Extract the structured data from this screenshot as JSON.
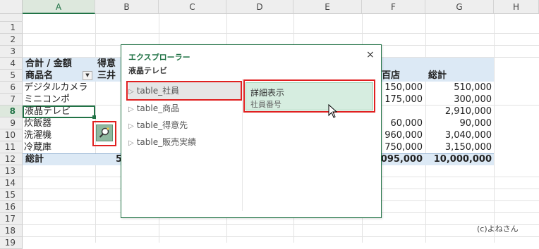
{
  "columns": [
    "A",
    "B",
    "C",
    "D",
    "E",
    "F",
    "G",
    "H"
  ],
  "rows": [
    "1",
    "2",
    "3",
    "4",
    "5",
    "6",
    "7",
    "8",
    "9",
    "10",
    "11",
    "12",
    "13",
    "14",
    "15",
    "16",
    "17",
    "18",
    "19"
  ],
  "sheet": {
    "r4_a": "合計 / 金額",
    "r4_b": "得意",
    "r5_a": "商品名",
    "r5_b": "三井",
    "r5_f": "百店",
    "r5_g": "総計",
    "r6_a": "デジタルカメラ",
    "r6_f": "150,000",
    "r6_g": "510,000",
    "r7_a": "ミニコンポ",
    "r7_f": "175,000",
    "r7_g": "300,000",
    "r8_a": "液晶テレビ",
    "r8_g": "2,910,000",
    "r9_a": "炊飯器",
    "r9_f": "60,000",
    "r9_g": "90,000",
    "r10_a": "洗濯機",
    "r10_f": "960,000",
    "r10_g": "3,040,000",
    "r11_a": "冷蔵庫",
    "r11_f": "750,000",
    "r11_g": "3,150,000",
    "r12_a": "総計",
    "r12_b": "5",
    "r12_f": "095,000",
    "r12_g": "10,000,000"
  },
  "explorer": {
    "title": "エクスプローラー",
    "close": "×",
    "subtitle": "液晶テレビ",
    "tables": [
      "table_社員",
      "table_商品",
      "table_得意先",
      "table_販売実績"
    ],
    "detail_title": "詳細表示",
    "detail_sub": "社員番号"
  },
  "copyright": "(c)よねさん",
  "colors": {
    "accent": "#217346",
    "highlight": "#e02020",
    "pivot": "#dce9f5"
  }
}
